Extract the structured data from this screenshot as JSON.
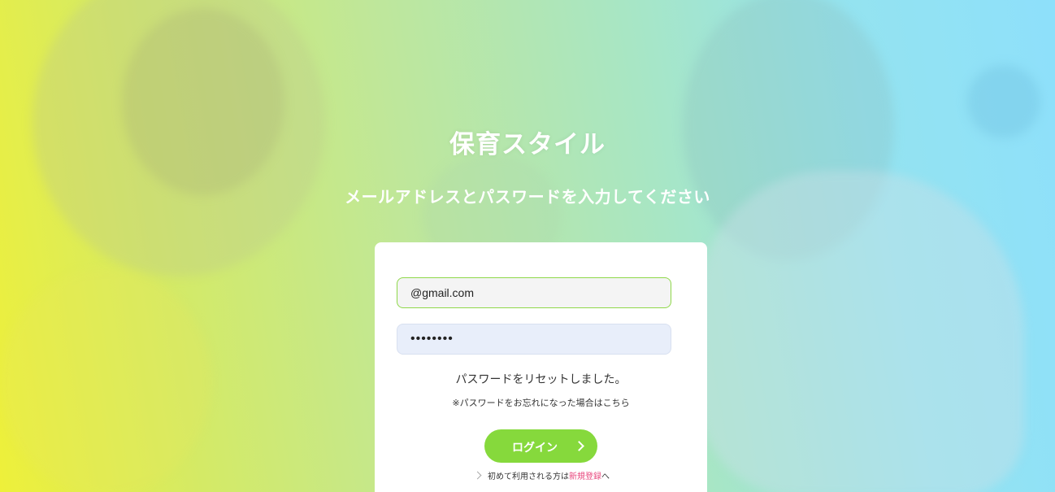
{
  "app": {
    "title": "保育スタイル",
    "subtitle": "メールアドレスとパスワードを入力してください"
  },
  "form": {
    "email_value": "@gmail.com",
    "password_value": "••••••••",
    "reset_message": "パスワードをリセットしました。",
    "forgot_link": "※パスワードをお忘れになった場合はこちら",
    "login_label": "ログイン",
    "register_prefix": "初めて利用される方は",
    "register_link": "新規登録",
    "register_suffix": "へ"
  },
  "icons": {
    "login_arrow": "chevron-right-icon",
    "register_arrow": "chevron-right-icon"
  },
  "colors": {
    "accent_green": "#86d93c",
    "link_pink": "#e8467c",
    "field_border_focus": "#8fd84a"
  }
}
